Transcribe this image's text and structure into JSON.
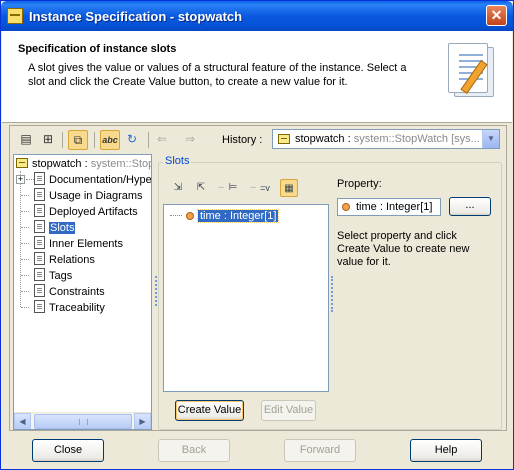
{
  "window": {
    "title": "Instance Specification - stopwatch",
    "close_glyph": "✕"
  },
  "header": {
    "title": "Specification of instance slots",
    "description": "A slot gives the value or values of a structural feature of the instance. Select a slot and click the Create Value button, to create a new value for it."
  },
  "toolbar": {
    "history_label": "History :",
    "history_value_name": "stopwatch : ",
    "history_value_type": "system::StopWatch [sys..."
  },
  "tree": {
    "root_name": "stopwatch : ",
    "root_type": "system::Stop",
    "items": [
      {
        "label": "Documentation/Hype"
      },
      {
        "label": "Usage in Diagrams"
      },
      {
        "label": "Deployed Artifacts"
      },
      {
        "label": "Slots",
        "selected": true
      },
      {
        "label": "Inner Elements"
      },
      {
        "label": "Relations"
      },
      {
        "label": "Tags"
      },
      {
        "label": "Constraints"
      },
      {
        "label": "Traceability"
      }
    ]
  },
  "slots": {
    "group_title": "Slots",
    "eq_label": "=v",
    "slot_item": "time : Integer[1]",
    "create_button": "Create Value",
    "edit_button": "Edit Value"
  },
  "property": {
    "label": "Property:",
    "value": "time : Integer[1]",
    "browse_button": "...",
    "help": "Select property and click Create Value to create new value for it."
  },
  "footer": {
    "close": "Close",
    "back": "Back",
    "forward": "Forward",
    "help": "Help"
  }
}
